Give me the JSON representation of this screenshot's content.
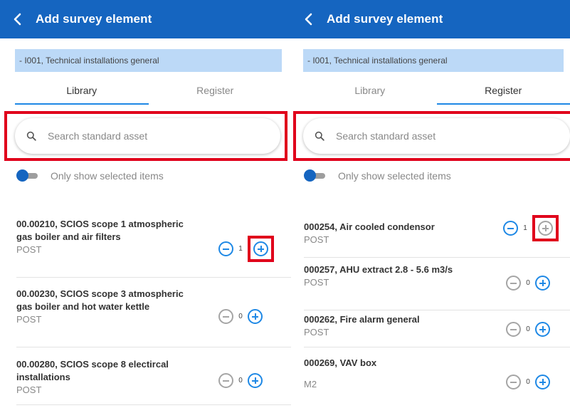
{
  "colors": {
    "appbar": "#1565c0",
    "accent": "#1e88e5",
    "highlight": "#e0001b",
    "context_bg": "#bcd9f7"
  },
  "left": {
    "title": "Add survey element",
    "context": "- I001, Technical installations general",
    "tabs": [
      {
        "label": "Library",
        "active": true
      },
      {
        "label": "Register",
        "active": false
      }
    ],
    "search": {
      "placeholder": "Search standard asset"
    },
    "toggle_label": "Only show selected items",
    "items": [
      {
        "title": "00.00210, SCIOS scope 1 atmospheric gas boiler and air filters",
        "sub": "POST",
        "count": "1"
      },
      {
        "title": "00.00230, SCIOS scope 3 atmospheric gas boiler and hot water kettle",
        "sub": "POST",
        "count": "0"
      },
      {
        "title": "00.00280, SCIOS scope 8 electircal installations",
        "sub": "POST",
        "count": "0"
      }
    ]
  },
  "right": {
    "title": "Add survey element",
    "context": "- I001, Technical installations general",
    "tabs": [
      {
        "label": "Library",
        "active": false
      },
      {
        "label": "Register",
        "active": true
      }
    ],
    "search": {
      "placeholder": "Search standard asset"
    },
    "toggle_label": "Only show selected items",
    "items": [
      {
        "title": "000254, Air cooled condensor",
        "sub": "POST",
        "count": "1"
      },
      {
        "title": "000257, AHU extract 2.8 - 5.6 m3/s",
        "sub": "POST",
        "count": "0"
      },
      {
        "title": "000262, Fire alarm general",
        "sub": "POST",
        "count": "0"
      },
      {
        "title": "000269, VAV box",
        "sub": "M2",
        "count": "0"
      }
    ]
  }
}
